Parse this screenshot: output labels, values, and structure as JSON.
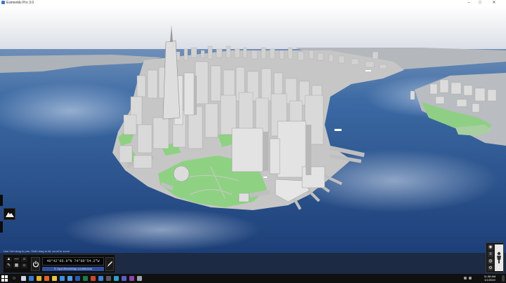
{
  "window": {
    "title": "Esimerkki Pro 3.0",
    "controls": {
      "minimize": "–",
      "maximize": "□",
      "close": "✕"
    }
  },
  "viewport": {
    "scene": "Lower Manhattan 3D city model",
    "colors": {
      "sky": "#eef0f3",
      "water": "#2e5c9a",
      "land": "#c9c9c9",
      "park": "#8fd183",
      "building": "#d8d8d8"
    }
  },
  "side_tools": {
    "fly_icon": "mountain-icon"
  },
  "navigation": {
    "caption": "Use Ctrl+drag to pan, Shift+drag to tilt, scroll to zoom",
    "coordinates": "40°42'05.9\"N 74°00'54.2\"W",
    "attribution": "© OpenStreetMap contributors",
    "tools": [
      "arrow-up-icon",
      "minus-icon",
      "home-icon",
      "select-icon",
      "ruler-icon",
      "grid-icon",
      "sun-icon"
    ],
    "power_icon": "power-icon",
    "edit_icon": "pencil-icon"
  },
  "right_panel": {
    "buttons": [
      "camera-icon",
      "layers-icon",
      "globe-icon",
      "settings-icon"
    ],
    "pegman_icon": "street-view-icon"
  },
  "taskbar": {
    "apps": [
      {
        "icon": "task-view-icon",
        "color": "#cfd6e6"
      },
      {
        "icon": "edge-icon",
        "color": "#2f7bd4"
      },
      {
        "icon": "chrome-icon",
        "color": "#e2b52a"
      },
      {
        "icon": "firefox-icon",
        "color": "#e2622a"
      },
      {
        "icon": "folder-icon",
        "color": "#e9c34b"
      },
      {
        "icon": "store-icon",
        "color": "#3f8de0"
      },
      {
        "icon": "mail-icon",
        "color": "#4f9be8"
      },
      {
        "icon": "word-icon",
        "color": "#2a5caa"
      },
      {
        "icon": "excel-icon",
        "color": "#1f7a45"
      },
      {
        "icon": "powerpoint-icon",
        "color": "#c84a2c"
      },
      {
        "icon": "photos-icon",
        "color": "#3d7fd6"
      },
      {
        "icon": "terminal-icon",
        "color": "#5a5a5a"
      },
      {
        "icon": "map-app-icon",
        "color": "#2ea0c8"
      },
      {
        "icon": "teams-icon",
        "color": "#5b5fc7"
      },
      {
        "icon": "notes-icon",
        "color": "#8e44ad"
      },
      {
        "icon": "settings-app-icon",
        "color": "#9aa3ad"
      }
    ],
    "time": "11:38 AM",
    "date": "1/1/2019"
  }
}
